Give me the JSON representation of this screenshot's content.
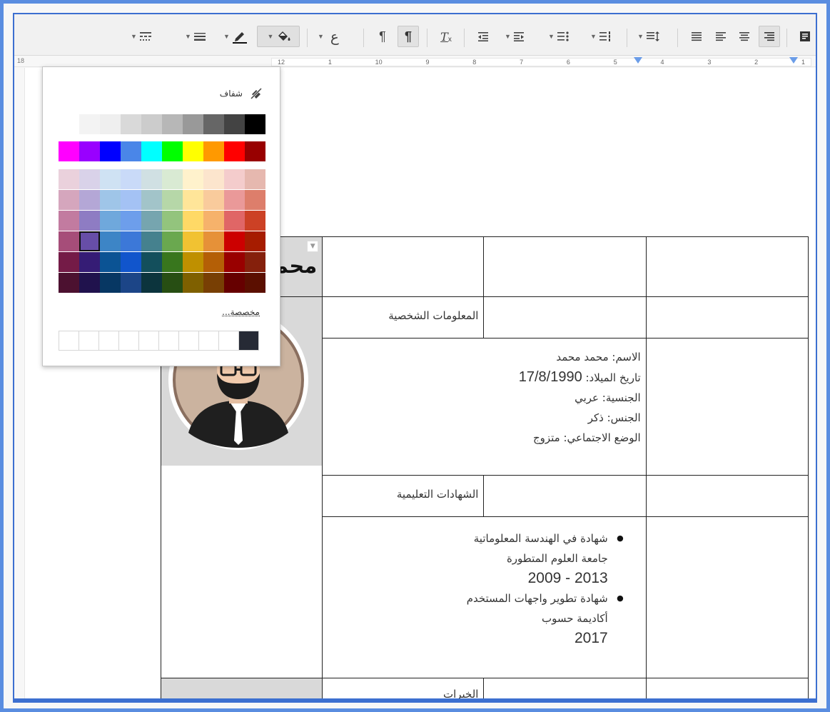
{
  "toolbar": {
    "items": [
      "indent-right",
      "align-right",
      "align-center",
      "align-left",
      "justify",
      "line-spacing",
      "numbered-list",
      "bulleted-list",
      "decrease-indent",
      "increase-indent",
      "clear-formatting",
      "ltr",
      "rtl",
      "equation",
      "highlight-color",
      "text-color",
      "line-style",
      "border-width",
      "border-dash"
    ],
    "equation_label": "ع"
  },
  "ruler": {
    "left_label": "18",
    "numbers": [
      "12",
      "1",
      "10",
      "9",
      "8",
      "7",
      "6",
      "5",
      "4",
      "3",
      "2",
      "1"
    ]
  },
  "palette": {
    "transparent_label": "شفاف",
    "custom_label": "مخصصة...",
    "greys": [
      "#000000",
      "#434343",
      "#666666",
      "#999999",
      "#b7b7b7",
      "#cccccc",
      "#d9d9d9",
      "#efefef",
      "#f3f3f3",
      "#ffffff"
    ],
    "brights": [
      "#980000",
      "#ff0000",
      "#ff9900",
      "#ffff00",
      "#00ff00",
      "#00ffff",
      "#4a86e8",
      "#0000ff",
      "#9900ff",
      "#ff00ff"
    ],
    "shades": [
      [
        "#e6b8af",
        "#f4cccc",
        "#fce5cd",
        "#fff2cc",
        "#d9ead3",
        "#d0e0e3",
        "#c9daf8",
        "#cfe2f3",
        "#d9d2e9",
        "#ead1dc"
      ],
      [
        "#dd7e6b",
        "#ea9999",
        "#f9cb9c",
        "#ffe599",
        "#b6d7a8",
        "#a2c4c9",
        "#a4c2f4",
        "#9fc5e8",
        "#b4a7d6",
        "#d5a6bd"
      ],
      [
        "#cc4125",
        "#e06666",
        "#f6b26b",
        "#ffd966",
        "#93c47d",
        "#76a5af",
        "#6d9eeb",
        "#6fa8dc",
        "#8e7cc3",
        "#c27ba0"
      ],
      [
        "#a61c00",
        "#cc0000",
        "#e69138",
        "#f1c232",
        "#6aa84f",
        "#45818e",
        "#3c78d8",
        "#3d85c6",
        "#674ea7",
        "#a64d79"
      ],
      [
        "#85200c",
        "#990000",
        "#b45f06",
        "#bf9000",
        "#38761d",
        "#134f5c",
        "#1155cc",
        "#0b5394",
        "#351c75",
        "#741b47"
      ],
      [
        "#5b0f00",
        "#660000",
        "#783f04",
        "#7f6000",
        "#274e13",
        "#0c343d",
        "#1c4587",
        "#073763",
        "#20124d",
        "#4c1130"
      ]
    ],
    "selected": "#674ea7",
    "custom": [
      "#262a35",
      "#ffffff",
      "#ffffff",
      "#ffffff",
      "#ffffff",
      "#ffffff",
      "#ffffff",
      "#ffffff",
      "#ffffff",
      "#ffffff"
    ]
  },
  "cv": {
    "name": "محمد محمد",
    "personal_heading": "المعلومات الشخصية",
    "name_line": "الاسم: محمد محمد",
    "birth_label": "تاريخ الميلاد: ",
    "birth_value": "17/8/1990",
    "nationality": "الجنسية: عربي",
    "gender": "الجنس: ذكر",
    "marital": "الوضع الاجتماعي: متزوج",
    "education_heading": "الشهادات التعليمية",
    "edu1_title": "شهادة في الهندسة المعلوماتية",
    "edu1_school": "جامعة العلوم المتطورة",
    "edu1_years": "2013 - 2009",
    "edu2_title": "شهادة تطوير واجهات المستخدم",
    "edu2_school": "أكاديمة حسوب",
    "edu2_year": "2017",
    "experience_heading": "الخبرات"
  }
}
